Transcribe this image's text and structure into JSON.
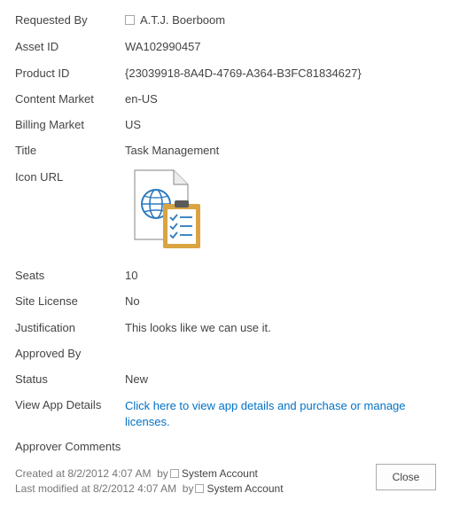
{
  "fields": {
    "requested_by": {
      "label": "Requested By",
      "value": "A.T.J. Boerboom"
    },
    "asset_id": {
      "label": "Asset ID",
      "value": "WA102990457"
    },
    "product_id": {
      "label": "Product ID",
      "value": "{23039918-8A4D-4769-A364-B3FC81834627}"
    },
    "content_market": {
      "label": "Content Market",
      "value": "en-US"
    },
    "billing_market": {
      "label": "Billing Market",
      "value": "US"
    },
    "title": {
      "label": "Title",
      "value": "Task Management"
    },
    "icon_url": {
      "label": "Icon URL",
      "icon": "task-management-app-icon"
    },
    "seats": {
      "label": "Seats",
      "value": "10"
    },
    "site_license": {
      "label": "Site License",
      "value": "No"
    },
    "justification": {
      "label": "Justification",
      "value": "This looks like we can use it."
    },
    "approved_by": {
      "label": "Approved By",
      "value": ""
    },
    "status": {
      "label": "Status",
      "value": "New"
    },
    "view_app_details": {
      "label": "View App Details",
      "link_text": "Click here to view app details and purchase or manage licenses."
    },
    "approver_comments": {
      "label": "Approver Comments",
      "value": ""
    }
  },
  "footer": {
    "created_prefix": "Created at 8/2/2012 4:07 AM",
    "created_by": "by",
    "created_user": "System Account",
    "modified_prefix": "Last modified at 8/2/2012 4:07 AM",
    "modified_by": "by",
    "modified_user": "System Account"
  },
  "actions": {
    "close_label": "Close"
  },
  "colors": {
    "link": "#0072c6",
    "icon_gold": "#d9a441",
    "icon_blue": "#2e7bbf"
  }
}
